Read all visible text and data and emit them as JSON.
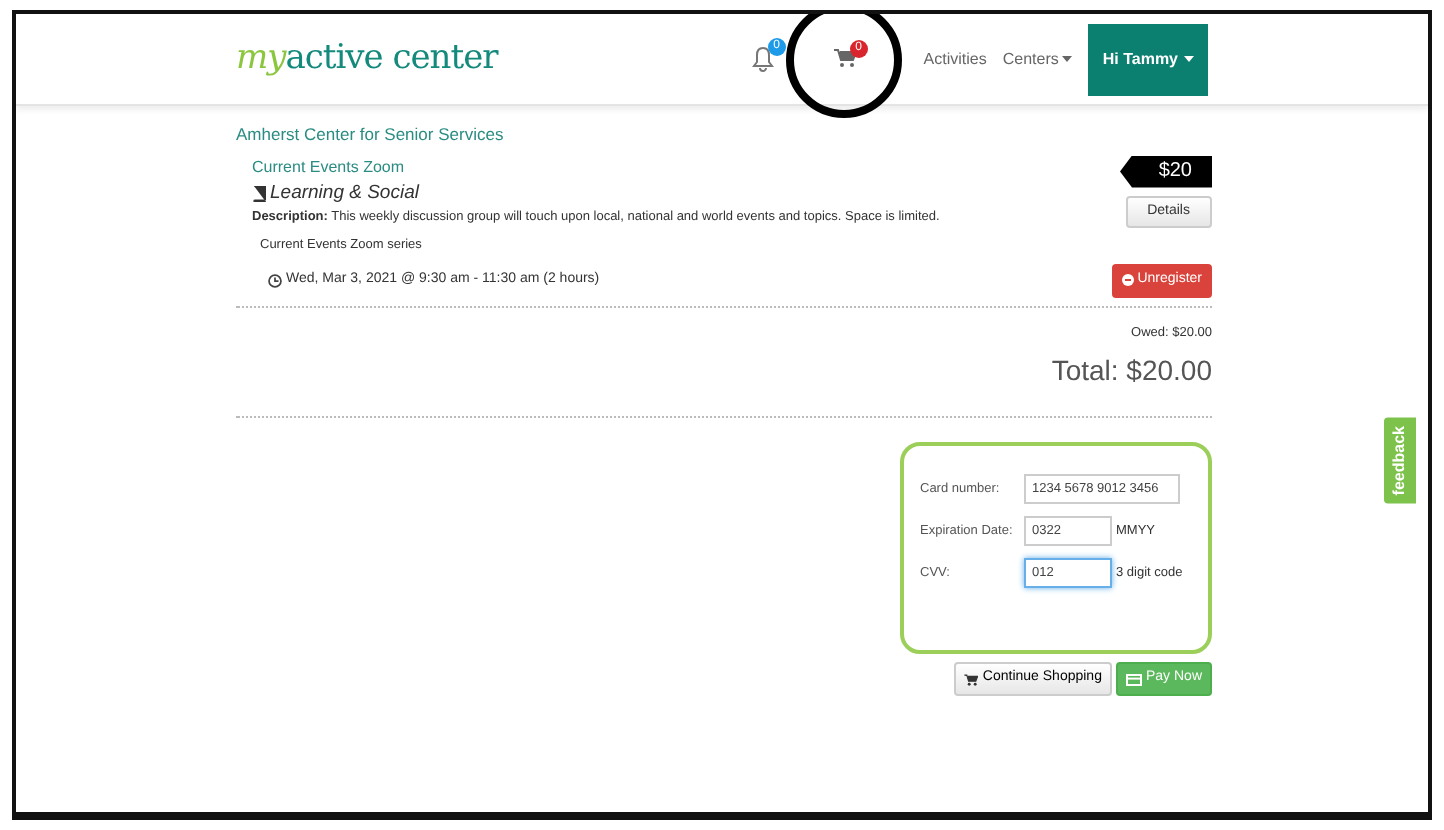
{
  "header": {
    "logo": {
      "prefix": "my",
      "name": "active center"
    },
    "notifications": {
      "count": "0"
    },
    "cart": {
      "count": "0"
    },
    "nav": [
      {
        "label": "Activities",
        "kind": "link"
      },
      {
        "label": "Centers",
        "kind": "menu"
      },
      {
        "label": "Hi Tammy",
        "kind": "account"
      }
    ]
  },
  "center_name": "Amherst Center for Senior Services",
  "activity": {
    "title": "Current Events Zoom",
    "category": "Learning & Social",
    "description": "**Description:** This weekly discussion group will touch upon local, national and world events and topics. Space is limited.",
    "price": "$20",
    "details_button": "Details",
    "series": "Current Events Zoom series",
    "session": "Wed, Mar 3, 2021 @ 9:30 am - 11:30 am (2 hours)",
    "unregister_button": "Unregister"
  },
  "owed": "Owed: $20.00",
  "total": "Total: $20.00",
  "payment": {
    "fields": [
      {
        "label": "Card number:",
        "value": "1234 5678 9012 3456",
        "focused": false
      },
      {
        "label": "Expiration Date:",
        "value": "0322",
        "hint": "MMYY",
        "focused": false
      },
      {
        "label": "CVV:",
        "value": "012",
        "hint": "3 digit code",
        "focused": true
      }
    ]
  },
  "buttons": [
    {
      "label": "Continue Shopping",
      "kind": "secondary"
    },
    {
      "label": "Pay Now",
      "kind": "primary"
    }
  ],
  "feedback": "feedback"
}
